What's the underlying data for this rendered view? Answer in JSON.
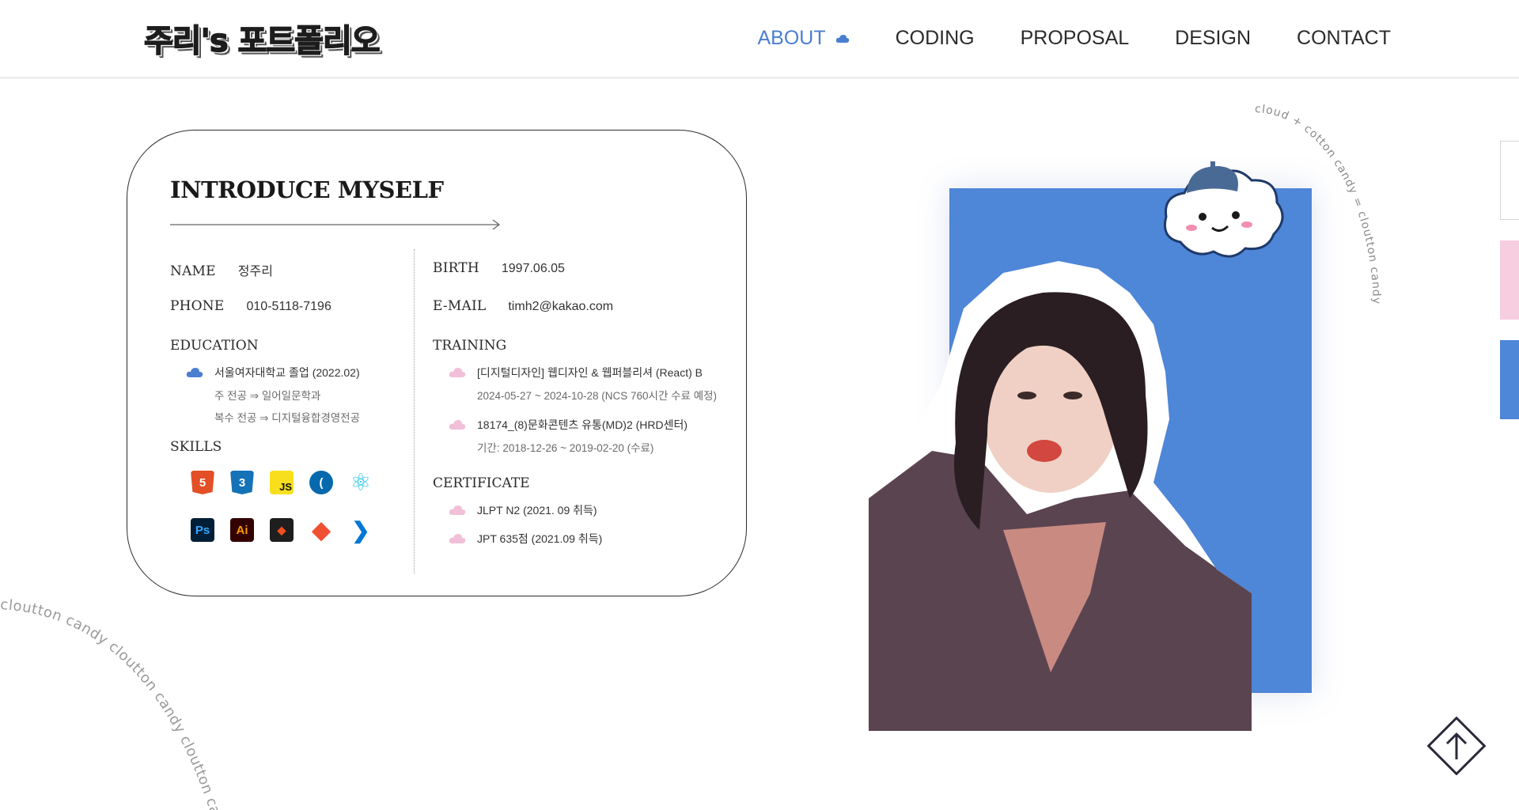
{
  "header": {
    "logo_text": "주리's 포트폴리오",
    "nav": [
      {
        "label": "ABOUT",
        "active": true
      },
      {
        "label": "CODING"
      },
      {
        "label": "PROPOSAL"
      },
      {
        "label": "DESIGN"
      },
      {
        "label": "CONTACT"
      }
    ]
  },
  "card": {
    "title": "INTRODUCE MYSELF",
    "name": {
      "label": "NAME",
      "value": "정주리"
    },
    "phone": {
      "label": "PHONE",
      "value": "010-5118-7196"
    },
    "birth": {
      "label": "BIRTH",
      "value": "1997.06.05"
    },
    "email": {
      "label": "E-MAIL",
      "value": "timh2@kakao.com"
    },
    "education": {
      "label": "EDUCATION",
      "school": "서울여자대학교 졸업 (2022.02)",
      "major": "주 전공 ⇒ 일어일문학과",
      "minor": "복수 전공 ⇒ 디지털융합경영전공"
    },
    "skills": {
      "label": "SKILLS",
      "items": [
        {
          "icon": "html5-icon",
          "glyph": "5",
          "bg": "#e34f26",
          "fg": "#ffffff"
        },
        {
          "icon": "css3-icon",
          "glyph": "3",
          "bg": "#1572b6",
          "fg": "#ffffff"
        },
        {
          "icon": "javascript-icon",
          "glyph": "JS",
          "bg": "#f7df1e",
          "fg": "#111111"
        },
        {
          "icon": "jquery-icon",
          "glyph": "(",
          "bg": "#0769ad",
          "fg": "#ffffff"
        },
        {
          "icon": "react-icon",
          "glyph": "⚛",
          "bg": "#ffffff",
          "fg": "#27c4e6"
        },
        {
          "icon": "photoshop-icon",
          "glyph": "Ps",
          "bg": "#001e36",
          "fg": "#31a8ff"
        },
        {
          "icon": "illustrator-icon",
          "glyph": "Ai",
          "bg": "#330000",
          "fg": "#ff9a00"
        },
        {
          "icon": "figma-icon",
          "glyph": "◆",
          "bg": "#1e1e1e",
          "fg": "#f24e1e"
        },
        {
          "icon": "git-icon",
          "glyph": "◆",
          "bg": "#ffffff",
          "fg": "#f05032"
        },
        {
          "icon": "vscode-icon",
          "glyph": "❯",
          "bg": "#ffffff",
          "fg": "#0078d4"
        }
      ]
    },
    "training": {
      "label": "TRAINING",
      "items": [
        {
          "main": "[디지털디자인] 웹디자인 & 웹퍼블리셔 (React) B",
          "sub": "2024-05-27 ~ 2024-10-28 (NCS 760시간 수료 예정)"
        },
        {
          "main": "18174_(8)문화콘텐츠 유통(MD)2 (HRD센터)",
          "sub": "기간: 2018-12-26 ~ 2019-02-20 (수료)"
        }
      ]
    },
    "certificate": {
      "label": "CERTIFICATE",
      "items": [
        {
          "main": "JLPT N2 (2021. 09 취득)"
        },
        {
          "main": "JPT 635점 (2021.09 취득)"
        }
      ]
    }
  },
  "decor": {
    "circle_text": "cloud + cotton candy = cloutton candy",
    "corner_text": "cloutton candy cloutton candy cloutton candy"
  },
  "colors": {
    "accent": "#4a7fd0",
    "photo_bg": "#4e86d8",
    "pink": "#f2bfd8",
    "tab_pink": "#f7cde0",
    "tab_blue": "#4e86d8"
  }
}
